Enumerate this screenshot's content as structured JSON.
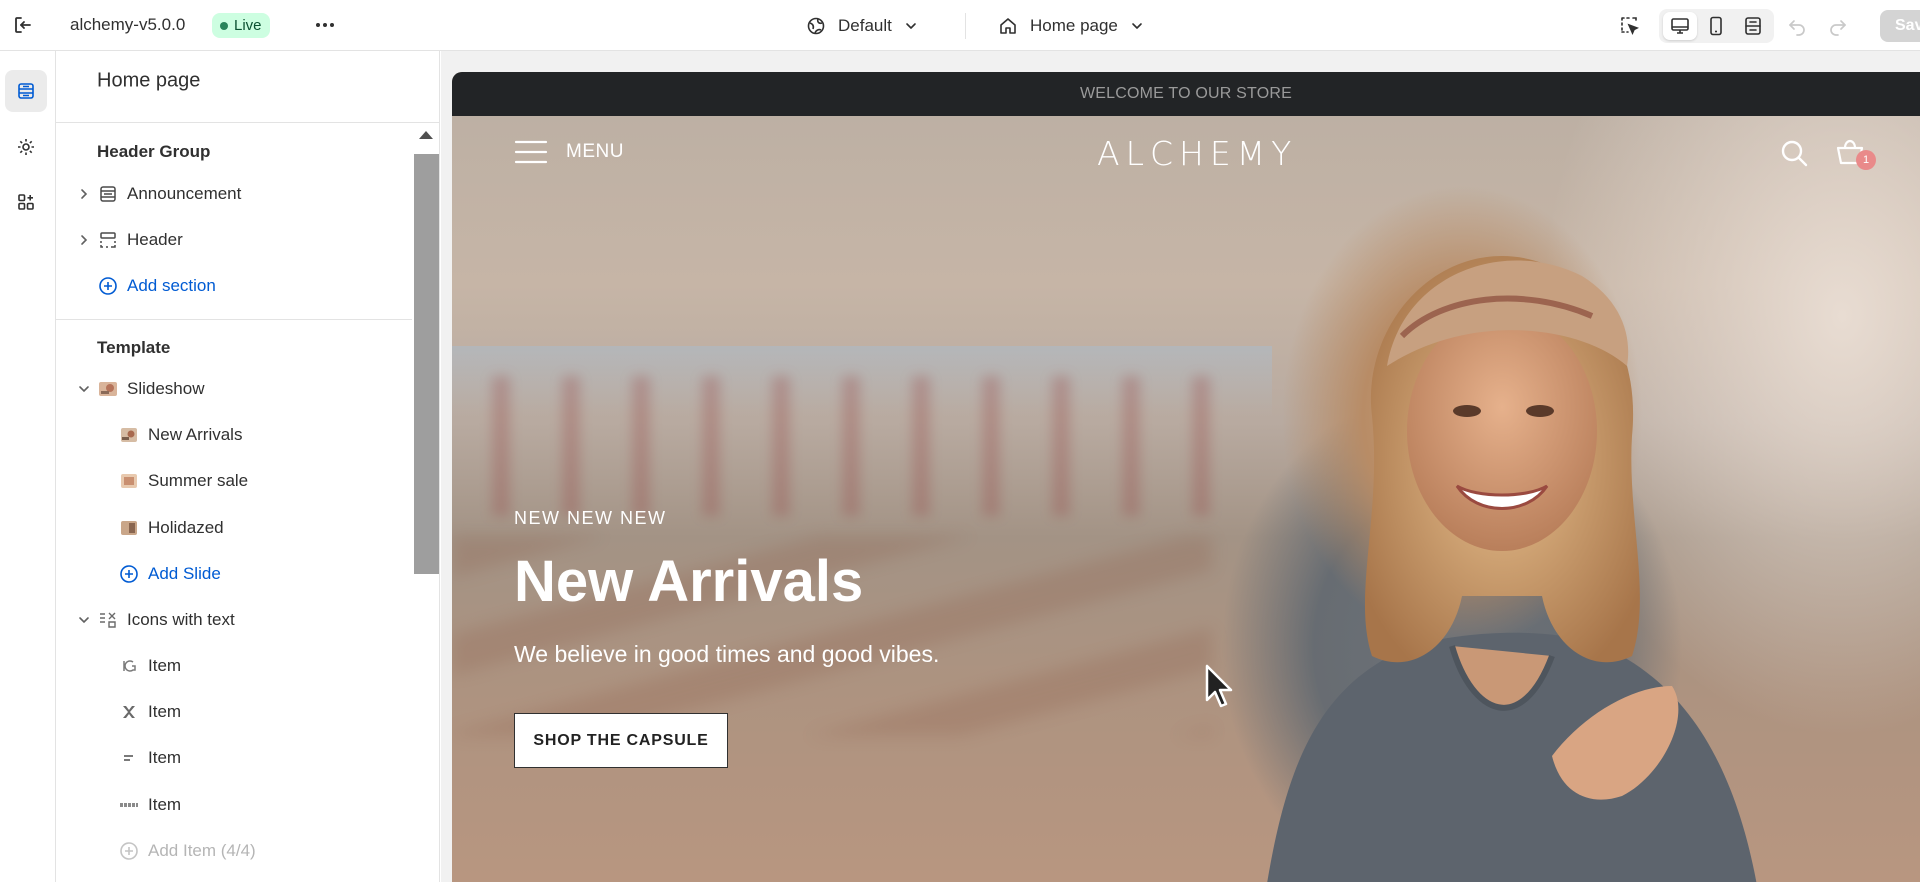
{
  "topbar": {
    "theme_name": "alchemy-v5.0.0",
    "live_badge": "Live",
    "template_selector": "Default",
    "page_selector": "Home page",
    "save_label": "Save"
  },
  "rail": {
    "items": [
      {
        "icon": "sections-icon",
        "active": true
      },
      {
        "icon": "gear-icon",
        "active": false
      },
      {
        "icon": "apps-icon",
        "active": false
      }
    ]
  },
  "sidebar": {
    "title": "Home page",
    "header_group": {
      "label": "Header Group",
      "items": [
        {
          "label": "Announcement",
          "icon": "announcement-bar-icon"
        },
        {
          "label": "Header",
          "icon": "header-layout-icon"
        }
      ],
      "add_label": "Add section"
    },
    "template": {
      "label": "Template",
      "slideshow": {
        "label": "Slideshow",
        "slides": [
          {
            "label": "New Arrivals"
          },
          {
            "label": "Summer sale"
          },
          {
            "label": "Holidazed"
          }
        ],
        "add_label": "Add Slide"
      },
      "icons_with_text": {
        "label": "Icons with text",
        "items": [
          {
            "label": "Item"
          },
          {
            "label": "Item"
          },
          {
            "label": "Item"
          },
          {
            "label": "Item"
          }
        ],
        "add_label": "Add Item (4/4)"
      }
    }
  },
  "preview": {
    "announcement": "WELCOME TO OUR STORE",
    "menu_label": "MENU",
    "logo": "ALCHEMY",
    "cart_count": "1",
    "slide": {
      "kicker": "NEW NEW NEW",
      "title": "New Arrivals",
      "subtitle": "We believe in good times and good vibes.",
      "button": "SHOP THE CAPSULE"
    }
  },
  "colors": {
    "link": "#005bd3",
    "live_bg": "#cdfee1",
    "live_text": "#0c5132",
    "announcement_bg": "#222426"
  }
}
